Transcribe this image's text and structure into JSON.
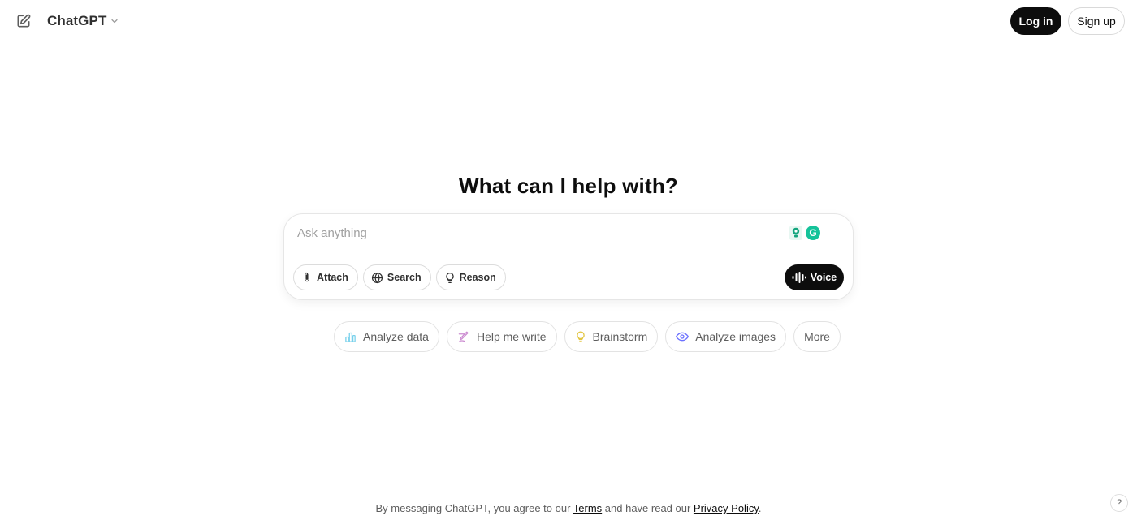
{
  "header": {
    "model_name": "ChatGPT",
    "login_label": "Log in",
    "signup_label": "Sign up",
    "icons": {
      "new_chat": "pencil-square-icon",
      "model_dropdown": "chevron-down-icon"
    }
  },
  "main": {
    "headline": "What can I help with?"
  },
  "composer": {
    "placeholder": "Ask anything",
    "value": "",
    "grammarly_label": "G",
    "tools": [
      {
        "label": "Attach",
        "icon": "paperclip-icon"
      },
      {
        "label": "Search",
        "icon": "globe-icon"
      },
      {
        "label": "Reason",
        "icon": "lightbulb-icon"
      }
    ],
    "voice_label": "Voice"
  },
  "suggestions": [
    {
      "label": "Analyze data",
      "icon": "bar-chart-icon",
      "color": "#76d0eb"
    },
    {
      "label": "Help me write",
      "icon": "pen-icon",
      "color": "#cb8bd0"
    },
    {
      "label": "Brainstorm",
      "icon": "lightbulb-icon",
      "color": "#e2c541"
    },
    {
      "label": "Analyze images",
      "icon": "eye-icon",
      "color": "#6c71ff"
    },
    {
      "label": "More",
      "icon": "",
      "color": ""
    }
  ],
  "footer": {
    "prefix": "By messaging ChatGPT, you agree to our ",
    "terms_label": "Terms",
    "middle": " and have read our ",
    "privacy_label": "Privacy Policy",
    "suffix": ".",
    "help_label": "?"
  },
  "colors": {
    "primary_button": "#0d0d0d",
    "grammarly": "#15c39a",
    "text": "#0d0d0d",
    "muted_text": "#5d5d5d"
  }
}
